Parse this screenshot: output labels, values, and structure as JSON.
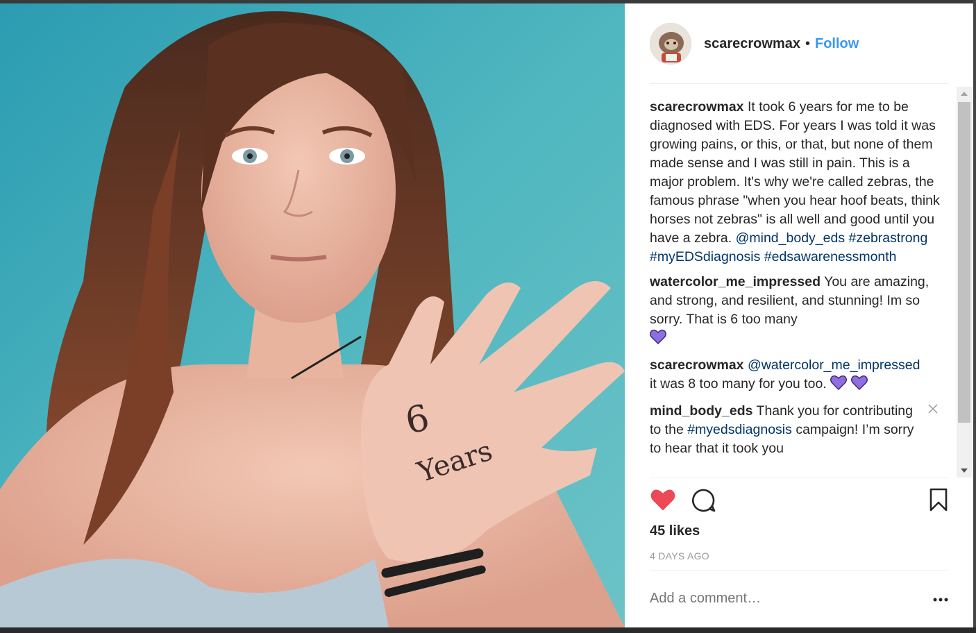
{
  "post": {
    "image_alt": "6 Years",
    "hand_text_number": "6",
    "hand_text_word": "Years",
    "username": "scarecrowmax",
    "separator": "•",
    "follow_label": "Follow"
  },
  "comments": [
    {
      "user": "scarecrowmax",
      "text": "It took 6 years for me to be diagnosed with EDS. For years I was told it was growing pains, or this, or that, but none of them made sense and I was still in pain. This is a major problem. It's why we're called zebras, the famous phrase \"when you hear hoof beats, think horses not zebras\" is all well and good until you have a zebra.",
      "mention": "@mind_body_eds",
      "tags": [
        "#zebrastrong",
        "#myEDSdiagnosis",
        "#edsawarenessmonth"
      ]
    },
    {
      "user": "watercolor_me_impressed",
      "text": "You are amazing, and strong, and resilient, and stunning! Im so sorry. That is 6 too many"
    },
    {
      "user": "scarecrowmax",
      "mention": "@watercolor_me_impressed",
      "text": "it was 8 too many for you too."
    },
    {
      "user": "mind_body_eds",
      "text_before": "Thank you for contributing to the",
      "tag": "#myedsdiagnosis",
      "text_after": "campaign! I’m sorry to hear that it took you"
    }
  ],
  "likes": "45 likes",
  "timestamp": "4 DAYS AGO",
  "add_comment_placeholder": "Add a comment…",
  "colors": {
    "link": "#003569",
    "follow": "#3897f0",
    "like_heart": "#ed4956",
    "purple_heart": "#8e6ee0"
  },
  "icons": [
    "heart-icon",
    "comment-icon",
    "bookmark-icon",
    "more-icon",
    "close-icon",
    "purple-heart-icon"
  ]
}
